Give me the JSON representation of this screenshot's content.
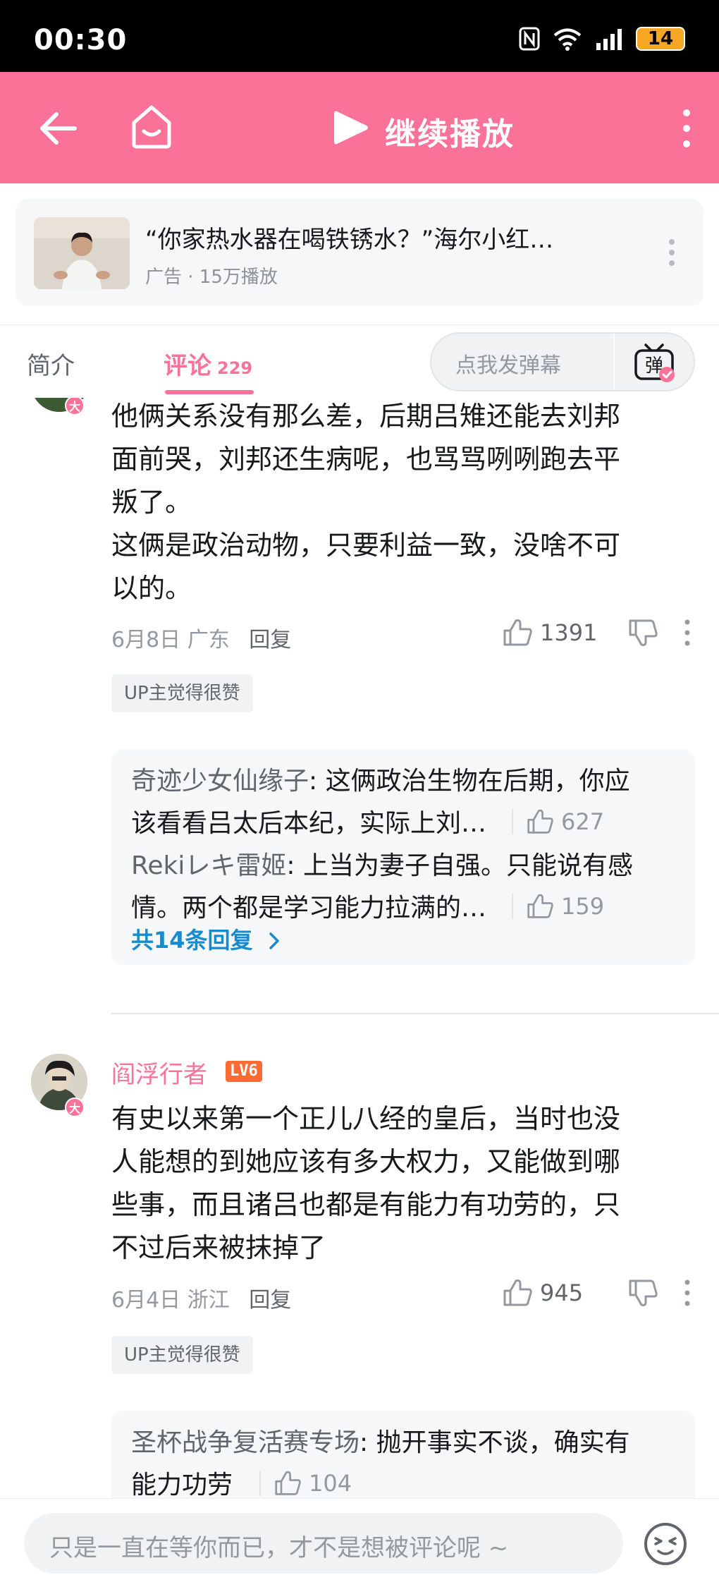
{
  "status_bar": {
    "time": "00:30",
    "battery": "14"
  },
  "header": {
    "title": "继续播放"
  },
  "ad": {
    "title": "“你家热水器在喝铁锈水？”海尔小红…",
    "meta": "广告 · 15万播放"
  },
  "tabs": {
    "intro": "简介",
    "comments": "评论",
    "comments_count": "229",
    "danmaku_placeholder": "点我发弹幕",
    "danmaku_icon_text": "弹"
  },
  "comments": [
    {
      "avatar_badge": "大",
      "lines": [
        "他俩关系没有那么差，后期吕雉还能去刘邦",
        "面前哭，刘邦还生病呢，也骂骂咧咧跑去平",
        "叛了。",
        "这俩是政治动物，只要利益一致，没啥不可",
        "以的。"
      ],
      "date": "6月8日",
      "location": "广东",
      "reply_label": "回复",
      "likes": "1391",
      "up_badge": "UP主觉得很赞",
      "replies": [
        {
          "user": "奇迹少女仙缘子",
          "line1": ": 这俩政治生物在后期，你应",
          "line2": "该看看吕太后本纪，实际上刘…",
          "likes": "627"
        },
        {
          "user": "Rekiレキ雷姬",
          "line1": ": 上当为妻子自强。只能说有感",
          "line2": "情。两个都是学习能力拉满的…",
          "likes": "159"
        }
      ],
      "more_replies": "共14条回复"
    },
    {
      "username": "阎浮行者",
      "level": "LV6",
      "avatar_badge": "大",
      "lines": [
        "有史以来第一个正儿八经的皇后，当时也没",
        "人能想的到她应该有多大权力，又能做到哪",
        "些事，而且诸吕也都是有能力有功劳的，只",
        "不过后来被抹掉了"
      ],
      "date": "6月4日",
      "location": "浙江",
      "reply_label": "回复",
      "likes": "945",
      "up_badge": "UP主觉得很赞",
      "replies": [
        {
          "user": "圣杯战争复活赛专场",
          "line1": ": 抛开事实不谈，确实有",
          "line2": "能力功劳",
          "likes": "104"
        }
      ]
    }
  ],
  "bottom": {
    "placeholder": "只是一直在等你而已，才不是想被评论呢 ~"
  },
  "colors": {
    "brand_pink": "#fb7299",
    "link_blue": "#178bcf"
  }
}
